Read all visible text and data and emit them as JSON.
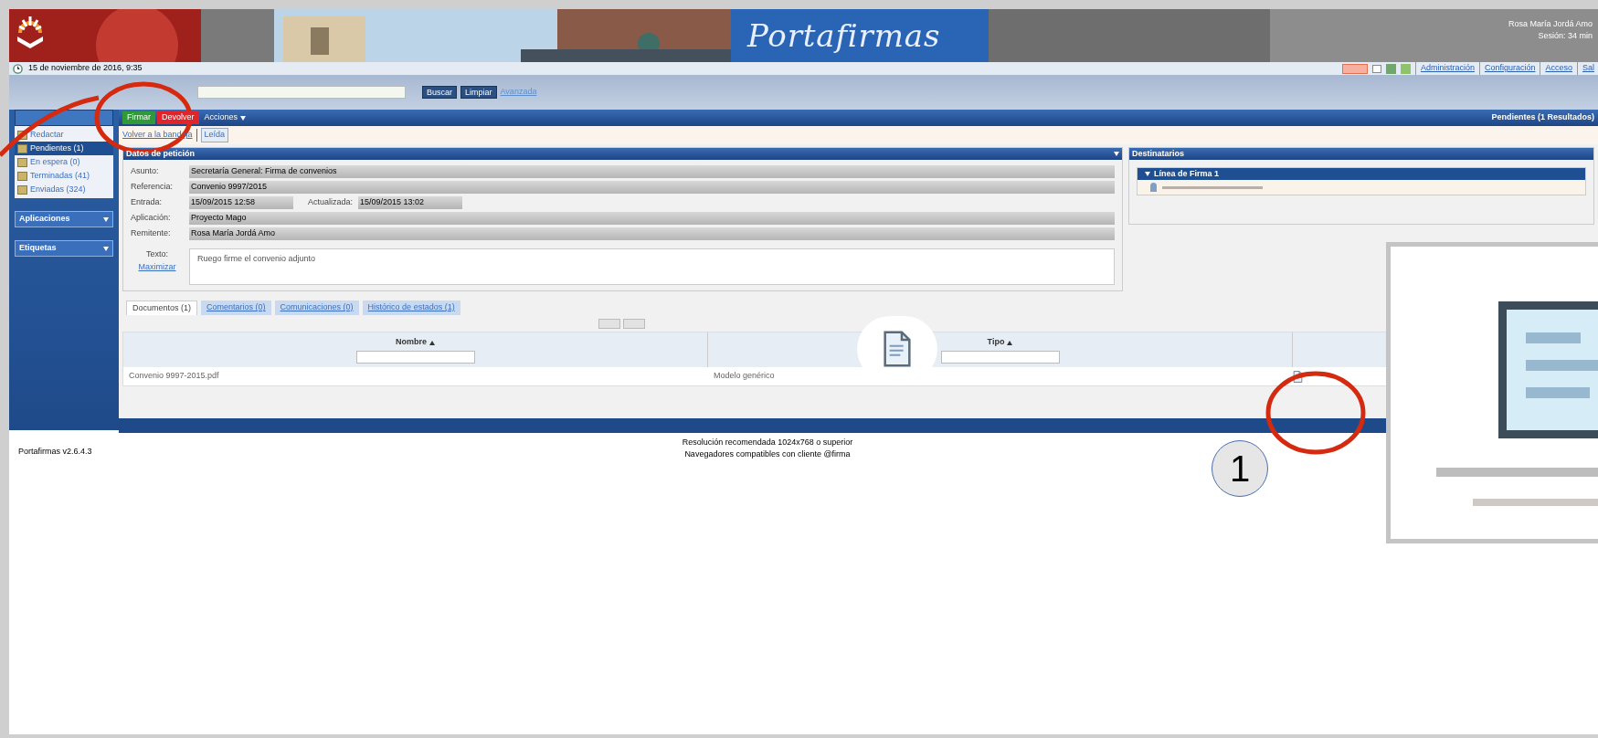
{
  "header": {
    "app_title": "Portafirmas",
    "user": "Rosa María Jordá Amo",
    "session": "Sesión: 34 min",
    "date": "15 de noviembre de 2016, 9:35",
    "links": [
      "Administración",
      "Configuración",
      "Acceso",
      "Sal"
    ]
  },
  "search": {
    "buttons": [
      "Buscar",
      "Limpiar"
    ],
    "advanced": "Avanzada"
  },
  "toolbar": {
    "buttons": [
      {
        "label": "Firmar",
        "kind": "sign"
      },
      {
        "label": "Devolver",
        "kind": "reject"
      }
    ],
    "menu": "Acciones",
    "results": "Pendientes (1 Resultados)"
  },
  "sidebar": {
    "items": [
      {
        "label": "Redactar",
        "selected": false
      },
      {
        "label": "Pendientes (1)",
        "selected": true
      },
      {
        "label": "En espera (0)",
        "selected": false
      },
      {
        "label": "Terminadas (41)",
        "selected": false
      },
      {
        "label": "Enviadas (324)",
        "selected": false
      }
    ],
    "sections": [
      "Aplicaciones",
      "Etiquetas"
    ]
  },
  "breadcrumb": {
    "back": "Volver a la bandeja",
    "state": "Leída"
  },
  "request": {
    "title": "Datos de petición",
    "fields": [
      {
        "label": "Asunto:",
        "value": "Secretaría General: Firma de convenios"
      },
      {
        "label": "Referencia:",
        "value": "Convenio 9997/2015"
      },
      {
        "label": "Entrada:",
        "value": "15/09/2015 12:58",
        "extra_label": "Actualizada:",
        "extra_value": "15/09/2015 13:02"
      },
      {
        "label": "Aplicación:",
        "value": "Proyecto Mago"
      },
      {
        "label": "Remitente:",
        "value": "Rosa María Jordá Amo"
      }
    ],
    "text_label": "Texto:",
    "maximize": "Maximizar",
    "text": "Ruego firme el convenio adjunto"
  },
  "recipients": {
    "title": "Destinatarios",
    "line": "Línea de Firma 1"
  },
  "tabs": [
    {
      "label": "Documentos (1)",
      "selected": true
    },
    {
      "label": "Comentarios (0)",
      "selected": false
    },
    {
      "label": "Comunicaciones (0)",
      "selected": false
    },
    {
      "label": "Histórico de estados (1)",
      "selected": false
    }
  ],
  "table": {
    "columns": [
      "Nombre",
      "Tipo"
    ],
    "rows": [
      {
        "name": "Convenio 9997-2015.pdf",
        "type": "Modelo genérico"
      }
    ]
  },
  "footer": {
    "version": "Portafirmas v2.6.4.3",
    "notes": [
      "Resolución recomendada 1024x768 o superior",
      "Navegadores compatibles con cliente @firma"
    ]
  },
  "callout": "1"
}
